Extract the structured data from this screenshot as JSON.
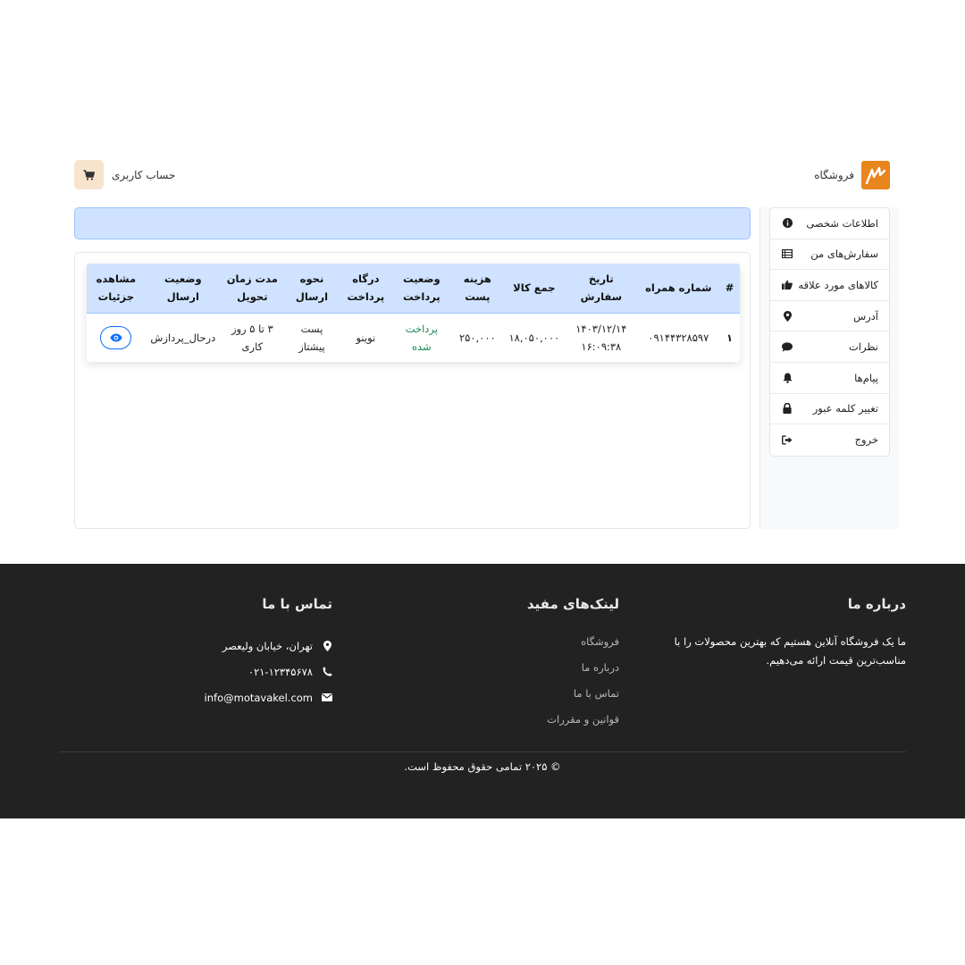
{
  "header": {
    "brand_name": "فروشگاه",
    "account_label": "حساب کاربری"
  },
  "sidebar": {
    "items": [
      {
        "label": "اطلاعات شخصی",
        "icon": "info-icon"
      },
      {
        "label": "سفارش‌های من",
        "icon": "list-icon"
      },
      {
        "label": "کالاهای مورد علاقه",
        "icon": "thumbs-up-icon"
      },
      {
        "label": "آدرس",
        "icon": "map-pin-icon"
      },
      {
        "label": "نظرات",
        "icon": "comment-icon"
      },
      {
        "label": "پیام‌ها",
        "icon": "bell-icon"
      },
      {
        "label": "تغییر کلمه عبور",
        "icon": "lock-icon"
      },
      {
        "label": "خروج",
        "icon": "sign-out-icon"
      }
    ]
  },
  "orders": {
    "headers": {
      "index": "#",
      "phone": "شماره همراه",
      "order_date": "تاریخ سفارش",
      "goods_total": "جمع کالا",
      "shipping_cost_1": "هزینه",
      "shipping_cost_2": "پست",
      "payment_status_1": "وضعیت",
      "payment_status_2": "پرداخت",
      "gateway_1": "درگاه",
      "gateway_2": "پرداخت",
      "shipping_method_1": "نحوه",
      "shipping_method_2": "ارسال",
      "delivery_time_1": "مدت زمان",
      "delivery_time_2": "تحویل",
      "shipping_status": "وضعیت ارسال",
      "details_1": "مشاهده",
      "details_2": "جزئیات"
    },
    "rows": [
      {
        "index": "۱",
        "phone": "۰۹۱۴۴۳۲۸۵۹۷",
        "date": "۱۴۰۳/۱۲/۱۴",
        "time": "۱۶:۰۹:۳۸",
        "goods_total": "۱۸,۰۵۰,۰۰۰",
        "shipping_cost": "۲۵۰,۰۰۰",
        "payment_status_1": "پرداخت",
        "payment_status_2": "شده",
        "gateway": "نوینو",
        "shipping_method_1": "پست",
        "shipping_method_2": "پیشتاز",
        "delivery_time_1": "۳ تا ۵ روز",
        "delivery_time_2": "کاری",
        "shipping_status": "درحال_پردازش"
      }
    ]
  },
  "footer": {
    "about_title": "درباره ما",
    "about_text": "ما یک فروشگاه آنلاین هستیم که بهترین محصولات را با مناسب‌ترین قیمت ارائه می‌دهیم.",
    "links_title": "لینک‌های مفید",
    "links": [
      "فروشگاه",
      "درباره ما",
      "تماس با ما",
      "قوانین و مقررات"
    ],
    "contact_title": "تماس با ما",
    "address": "تهران، خیابان ولیعصر",
    "phone": "۰۲۱-۱۲۳۴۵۶۷۸",
    "email": "info@motavakel.com",
    "copyright": "© ۲۰۲۵ تمامی حقوق محفوظ است."
  },
  "colors": {
    "brand": "#e8851c",
    "table_header": "#cfe2ff",
    "paid": "#198754",
    "footer_bg": "#222222",
    "primary": "#0d6efd"
  }
}
